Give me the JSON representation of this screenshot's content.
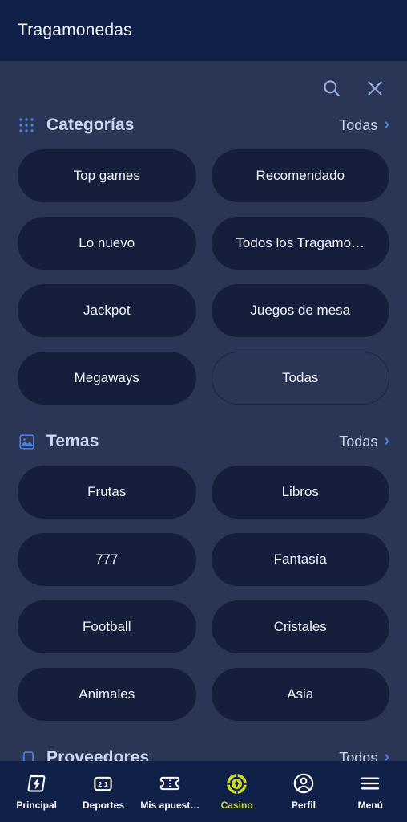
{
  "appbar": {
    "title": "Tragamonedas"
  },
  "sheet_actions": {
    "search_icon": "search-icon",
    "close_icon": "close-icon"
  },
  "sections": [
    {
      "id": "categorias",
      "icon": "grid-dots-icon",
      "title": "Categorías",
      "more_label": "Todas",
      "chips": [
        {
          "label": "Top games",
          "style": "filled"
        },
        {
          "label": "Recomendado",
          "style": "filled"
        },
        {
          "label": "Lo nuevo",
          "style": "filled"
        },
        {
          "label": "Todos los Tragamo…",
          "style": "filled"
        },
        {
          "label": "Jackpot",
          "style": "filled"
        },
        {
          "label": "Juegos de mesa",
          "style": "filled"
        },
        {
          "label": "Megaways",
          "style": "filled"
        },
        {
          "label": "Todas",
          "style": "outline"
        }
      ]
    },
    {
      "id": "temas",
      "icon": "image-icon",
      "title": "Temas",
      "more_label": "Todas",
      "chips": [
        {
          "label": "Frutas",
          "style": "filled"
        },
        {
          "label": "Libros",
          "style": "filled"
        },
        {
          "label": "777",
          "style": "filled"
        },
        {
          "label": "Fantasía",
          "style": "filled"
        },
        {
          "label": "Football",
          "style": "filled"
        },
        {
          "label": "Cristales",
          "style": "filled"
        },
        {
          "label": "Animales",
          "style": "filled"
        },
        {
          "label": "Asia",
          "style": "filled"
        }
      ]
    },
    {
      "id": "proveedores",
      "icon": "layers-icon",
      "title": "Proveedores",
      "more_label": "Todos",
      "chips": []
    }
  ],
  "bottom_nav": {
    "items": [
      {
        "label": "Principal",
        "icon": "lightning-bolt-icon",
        "active": false
      },
      {
        "label": "Deportes",
        "icon": "scoreboard-icon",
        "active": false
      },
      {
        "label": "Mis apuest…",
        "icon": "ticket-icon",
        "active": false
      },
      {
        "label": "Casino",
        "icon": "casino-chip-icon",
        "active": true
      },
      {
        "label": "Perfil",
        "icon": "user-circle-icon",
        "active": false
      },
      {
        "label": "Menú",
        "icon": "hamburger-menu-icon",
        "active": false
      }
    ]
  },
  "colors": {
    "appbar_bg": "#102048",
    "page_bg": "#2b3556",
    "chip_bg": "#151f3c",
    "chip_outline_border": "#1b2647",
    "accent_green": "#c8dd32",
    "accent_blue": "#4a7fe0",
    "section_title": "#ccd7ef"
  }
}
